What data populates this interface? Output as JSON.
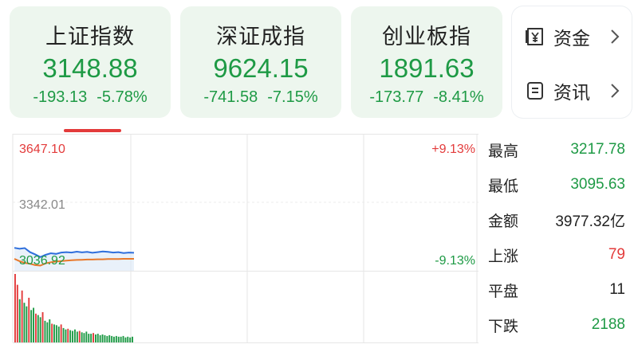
{
  "indices": [
    {
      "name": "上证指数",
      "price": "3148.88",
      "change": "-193.13",
      "pct": "-5.78%"
    },
    {
      "name": "深证成指",
      "price": "9624.15",
      "change": "-741.58",
      "pct": "-7.15%"
    },
    {
      "name": "创业板指",
      "price": "1891.63",
      "change": "-173.77",
      "pct": "-8.41%"
    }
  ],
  "side_menu": {
    "funds_label": "资金",
    "news_label": "资讯"
  },
  "chart": {
    "y_top": "3647.10",
    "y_mid": "3342.01",
    "y_bottom": "3036.92",
    "pct_top": "+9.13%",
    "pct_bottom": "-9.13%"
  },
  "stats": [
    {
      "label": "最高",
      "value": "3217.78",
      "color": "#1e9a45"
    },
    {
      "label": "最低",
      "value": "3095.63",
      "color": "#1e9a45"
    },
    {
      "label": "金额",
      "value": "3977.32亿",
      "color": "#222222"
    },
    {
      "label": "上涨",
      "value": "79",
      "color": "#e33b3b"
    },
    {
      "label": "平盘",
      "value": "11",
      "color": "#222222"
    },
    {
      "label": "下跌",
      "value": "2188",
      "color": "#1e9a45"
    }
  ],
  "colors": {
    "up": "#e33b3b",
    "down": "#1e9a45",
    "price_line": "#2f6fdc",
    "avg_line": "#e8782a"
  },
  "chart_data": {
    "type": "line",
    "ylim": [
      3036.92,
      3647.1
    ],
    "price_series": [
      3139,
      3135,
      3138,
      3120,
      3110,
      3098,
      3108,
      3115,
      3112,
      3118,
      3120,
      3118,
      3122,
      3119,
      3121,
      3117,
      3120,
      3123,
      3121,
      3118,
      3120,
      3116,
      3118,
      3117
    ],
    "avg_series": [
      3090,
      3080,
      3072,
      3068,
      3062,
      3060,
      3070,
      3075,
      3078,
      3080,
      3082,
      3084,
      3085,
      3086,
      3087,
      3087,
      3088,
      3088,
      3089,
      3089,
      3089,
      3090,
      3090,
      3090
    ],
    "volume": {
      "colors": [
        "up",
        "up",
        "down",
        "up",
        "down",
        "down",
        "up",
        "down",
        "down",
        "up",
        "down",
        "down",
        "up",
        "down",
        "down",
        "down",
        "up",
        "down",
        "down",
        "down",
        "up",
        "down",
        "down",
        "up",
        "down",
        "down",
        "down",
        "down",
        "up",
        "down",
        "down",
        "down",
        "down",
        "down",
        "up",
        "down",
        "down",
        "down",
        "down",
        "down",
        "down",
        "down",
        "down",
        "down",
        "down",
        "down",
        "down",
        "down",
        "down",
        "down",
        "down",
        "down"
      ],
      "values": [
        95,
        80,
        60,
        72,
        55,
        50,
        62,
        45,
        48,
        40,
        38,
        35,
        42,
        30,
        28,
        32,
        26,
        25,
        24,
        22,
        25,
        20,
        18,
        19,
        17,
        16,
        18,
        15,
        16,
        14,
        13,
        15,
        12,
        12,
        13,
        11,
        12,
        10,
        11,
        10,
        9,
        10,
        9,
        8,
        9,
        8,
        8,
        9,
        7,
        8,
        7,
        8
      ]
    }
  }
}
